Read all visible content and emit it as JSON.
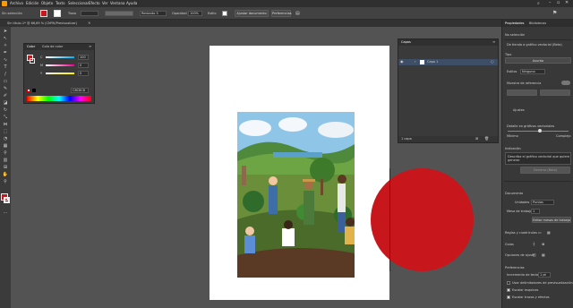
{
  "menubar": {
    "items": [
      "Archivo",
      "Edición",
      "Objeto",
      "Texto",
      "Seleccionar",
      "Efecto",
      "Ver",
      "Ventana",
      "Ayuda"
    ]
  },
  "controlbar": {
    "selection_label": "Sin selección",
    "stroke_label": "Trazo",
    "style_label": "Redondo 5",
    "opacity_label": "Opacidad",
    "opacity_value": "100%",
    "style2_label": "Estilo",
    "doc_setup_button": "Ajustar documento",
    "prefs_button": "Preferencias"
  },
  "doctab": {
    "title": "Sin título-1* @ 66,69 % (CMYK/Previsualizar)"
  },
  "color_panel": {
    "tab_color": "Color",
    "tab_guide": "Guía de color",
    "c_label": "C",
    "c_value": "100",
    "m_label": "M",
    "m_value": "0",
    "y_label": "Y",
    "y_value": "0",
    "hex_value": "C8C8C8"
  },
  "layers_panel": {
    "tab": "Capas",
    "layer_name": "Capa 1",
    "count": "1 capa"
  },
  "properties": {
    "tab_props": "Propiedades",
    "tab_libraries": "Bibliotecas",
    "no_selection": "No selección",
    "convert_label": "De tienda a gráfico vectorial (Beta)",
    "type_label": "Tipo",
    "type_value": "Asunto",
    "styles_label": "Estilos",
    "styles_value": "Ninguno",
    "reference_label": "Muestra de referencia",
    "settings_label": "Ajustes",
    "detail_label": "Detalle en gráficos vectoriales",
    "minimum": "Mínimo",
    "complex": "Complejo",
    "prompt_label": "Indicación",
    "prompt_text": "Describa el gráfico vectorial que quiere generar",
    "generate_button": "Generar (Beta)",
    "document_label": "Documento",
    "units_label": "Unidades",
    "units_value": "Puntos",
    "artboard_label": "Mesa de trabajo",
    "artboard_value": "1",
    "edit_artboards_button": "Editar mesas de trabajo",
    "rulers_label": "Reglas y cuadrículas",
    "guides_label": "Guías",
    "snap_label": "Opciones de ajuste",
    "prefs_label": "Preferencias",
    "keyboard_label": "Incremento de teclado",
    "keyboard_value": "1 pt",
    "check1": "Usar delimitadores de previsualización",
    "check2": "Escalar esquinas",
    "check3": "Escalar trazos y efectos"
  },
  "colors": {
    "fill": "#c8161d",
    "circle": "#c8161d",
    "accent": "#2d6fd3"
  }
}
